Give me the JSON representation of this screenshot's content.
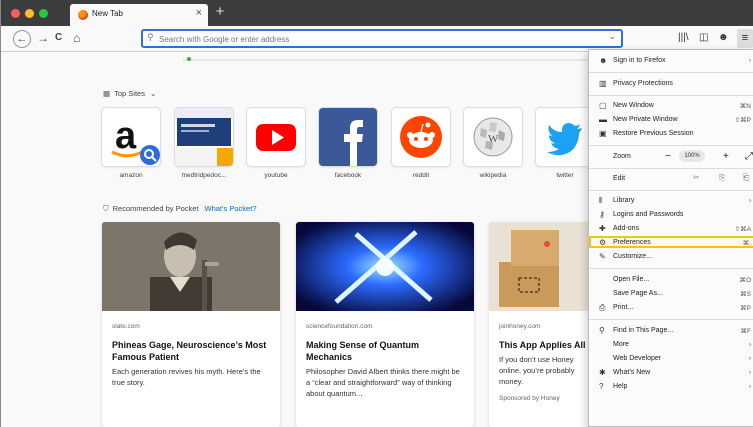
{
  "window": {
    "tab_title": "New Tab",
    "tab_close": "×",
    "newtab_plus": "+"
  },
  "navbar": {
    "back_glyph": "←",
    "forward_glyph": "→",
    "reload_glyph": "C",
    "home_glyph": "⌂",
    "search_glyph": "⚲",
    "url_placeholder": "Search with Google or enter address",
    "dropdown_glyph": "⌄",
    "library_glyph": "|||\\",
    "sidebar_glyph": "◫",
    "account_glyph": "☻",
    "menu_glyph": "≡"
  },
  "topsites": {
    "header": "Top Sites",
    "header_icon": "▦",
    "header_chevron": "⌄",
    "sites": [
      {
        "label": "amazon"
      },
      {
        "label": "medtridpedoc..."
      },
      {
        "label": "youtube"
      },
      {
        "label": "facebook"
      },
      {
        "label": "reddit"
      },
      {
        "label": "wikipedia"
      },
      {
        "label": "twitter"
      }
    ]
  },
  "pocket": {
    "header": "Recommended by Pocket",
    "header_icon": "⛉",
    "link": "What’s Pocket?"
  },
  "cards": [
    {
      "source": "slate.com",
      "title": "Phineas Gage, Neuroscience’s Most Famous Patient",
      "desc": "Each generation revives his myth. Here’s the true story."
    },
    {
      "source": "sciencefoundation.com",
      "title": "Making Sense of Quantum Mechanics",
      "desc": "Philosopher David Albert thinks there might be a “clear and straightforward” way of thinking about quantum..."
    },
    {
      "source": "joinhoney.com",
      "title": "This App Applies All Codes to Your Cart",
      "desc": "If you don’t use Honey online, you’re probably money.",
      "sponsor": "Sponsored by Honey"
    }
  ],
  "menu": {
    "signin": "Sign in to Firefox",
    "protections": "Privacy Protections",
    "new_window": "New Window",
    "new_window_sc": "⌘N",
    "private_window": "New Private Window",
    "private_window_sc": "⇧⌘P",
    "restore": "Restore Previous Session",
    "zoom": "Zoom",
    "zoom_minus": "−",
    "zoom_value": "100%",
    "zoom_plus": "+",
    "zoom_full": "⤢",
    "edit": "Edit",
    "cut": "✂",
    "copy": "⎘",
    "paste": "⎗",
    "library": "Library",
    "logins": "Logins and Passwords",
    "addons": "Add-ons",
    "addons_sc": "⇧⌘A",
    "preferences": "Preferences",
    "preferences_sc": "⌘,",
    "customize": "Customize...",
    "open_file": "Open File...",
    "open_file_sc": "⌘O",
    "save_page": "Save Page As...",
    "save_page_sc": "⌘S",
    "print": "Print...",
    "print_sc": "⌘P",
    "find": "Find in This Page...",
    "find_sc": "⌘F",
    "more": "More",
    "web_dev": "Web Developer",
    "whats_new": "What’s New",
    "help": "Help",
    "arrow": "›"
  }
}
